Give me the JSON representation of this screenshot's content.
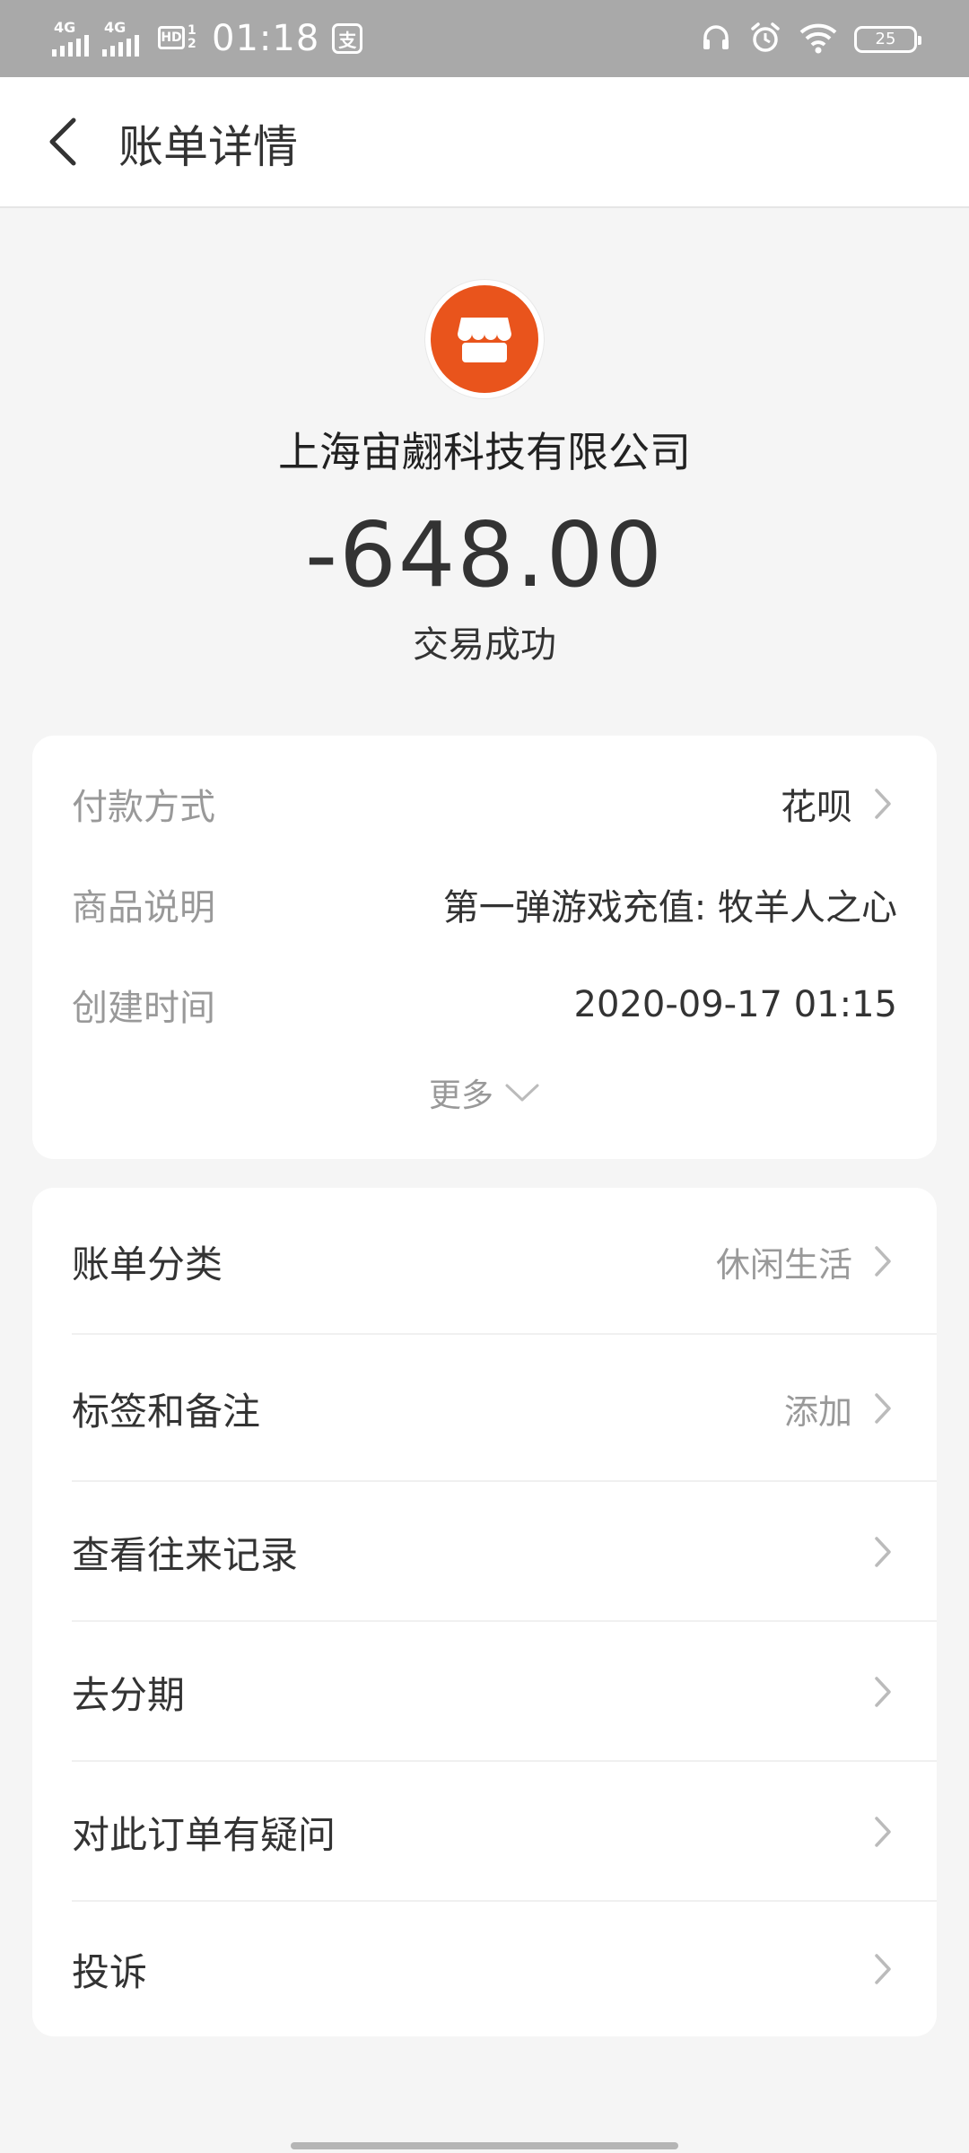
{
  "status_bar": {
    "signal1_label": "4G",
    "signal2_label": "4G",
    "hd_label": "HD",
    "hd_sub_top": "1",
    "hd_sub_bottom": "2",
    "time": "01:18",
    "app_badge": "支",
    "battery_level": "25",
    "icons": [
      "headset-icon",
      "alarm-icon",
      "wifi-icon",
      "battery-icon"
    ]
  },
  "header": {
    "title": "账单详情"
  },
  "summary": {
    "merchant_name": "上海宙翽科技有限公司",
    "amount": "-648.00",
    "status": "交易成功",
    "logo_color": "#e9541c"
  },
  "details": {
    "rows": [
      {
        "label": "付款方式",
        "value": "花呗"
      },
      {
        "label": "商品说明",
        "value": "第一弹游戏充值: 牧羊人之心"
      },
      {
        "label": "创建时间",
        "value": "2020-09-17 01:15"
      }
    ],
    "more_label": "更多"
  },
  "actions": {
    "items": [
      {
        "label": "账单分类",
        "value": "休闲生活"
      },
      {
        "label": "标签和备注",
        "value": "添加"
      },
      {
        "label": "查看往来记录",
        "value": ""
      },
      {
        "label": "去分期",
        "value": ""
      },
      {
        "label": "对此订单有疑问",
        "value": ""
      },
      {
        "label": "投诉",
        "value": ""
      }
    ]
  }
}
